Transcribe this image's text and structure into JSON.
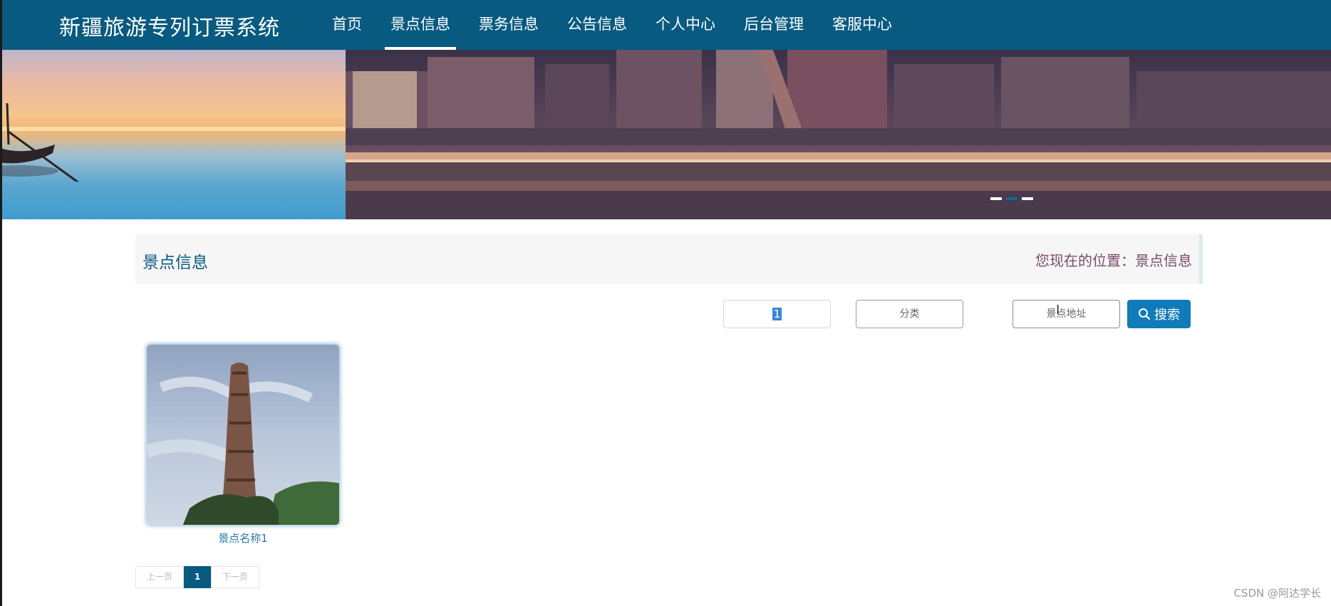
{
  "header": {
    "site_title": "新疆旅游专列订票系统",
    "nav": [
      {
        "label": "首页",
        "active": false
      },
      {
        "label": "景点信息",
        "active": true
      },
      {
        "label": "票务信息",
        "active": false
      },
      {
        "label": "公告信息",
        "active": false
      },
      {
        "label": "个人中心",
        "active": false
      },
      {
        "label": "后台管理",
        "active": false
      },
      {
        "label": "客服中心",
        "active": false
      }
    ]
  },
  "carousel": {
    "slide_count": 3,
    "active_index": 1
  },
  "breadcrumb": {
    "title": "景点信息",
    "location": "您现在的位置：景点信息"
  },
  "search": {
    "name_value": "1",
    "category_placeholder": "分类",
    "address_placeholder": "景点地址",
    "button_label": "搜索"
  },
  "items": [
    {
      "name": "景点名称1"
    }
  ],
  "pagination": {
    "prev_label": "上一页",
    "current_page": "1",
    "next_label": "下一页"
  },
  "watermark": "CSDN @阿达学长",
  "colors": {
    "nav_bg": "#085a80",
    "accent": "#0f7bb8",
    "location_text": "#7a4b68"
  }
}
